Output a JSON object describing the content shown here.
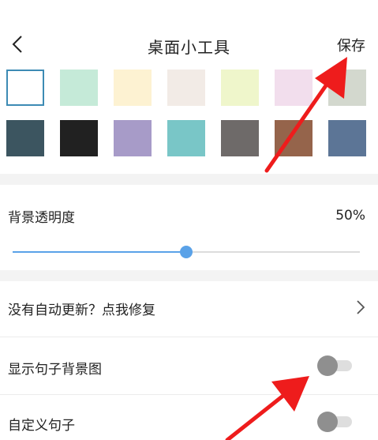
{
  "header": {
    "back_icon": "chevron-left-icon",
    "title": "桌面小工具",
    "save_label": "保存"
  },
  "swatches": {
    "row1": [
      {
        "color": "#ffffff",
        "selected": true
      },
      {
        "color": "#c5ead8",
        "selected": false
      },
      {
        "color": "#fdf2d2",
        "selected": false
      },
      {
        "color": "#f2ebe6",
        "selected": false
      },
      {
        "color": "#eff6cb",
        "selected": false
      },
      {
        "color": "#f2deed",
        "selected": false
      },
      {
        "color": "#d3d8ce",
        "selected": false
      }
    ],
    "row2": [
      {
        "color": "#3c5560"
      },
      {
        "color": "#212121"
      },
      {
        "color": "#a79bc8"
      },
      {
        "color": "#79c6c7"
      },
      {
        "color": "#6e6a69"
      },
      {
        "color": "#95644b"
      },
      {
        "color": "#5c7596"
      }
    ]
  },
  "opacity": {
    "label": "背景透明度",
    "value_text": "50%",
    "value": 0.5
  },
  "settings": {
    "repair_label": "没有自动更新？点我修复",
    "repair_icon": "chevron-right-icon",
    "show_bg_label": "显示句子背景图",
    "show_bg_on": false,
    "custom_label": "自定义句子",
    "custom_on": false
  },
  "annotations": {
    "arrow_color": "#ee1c1c"
  }
}
